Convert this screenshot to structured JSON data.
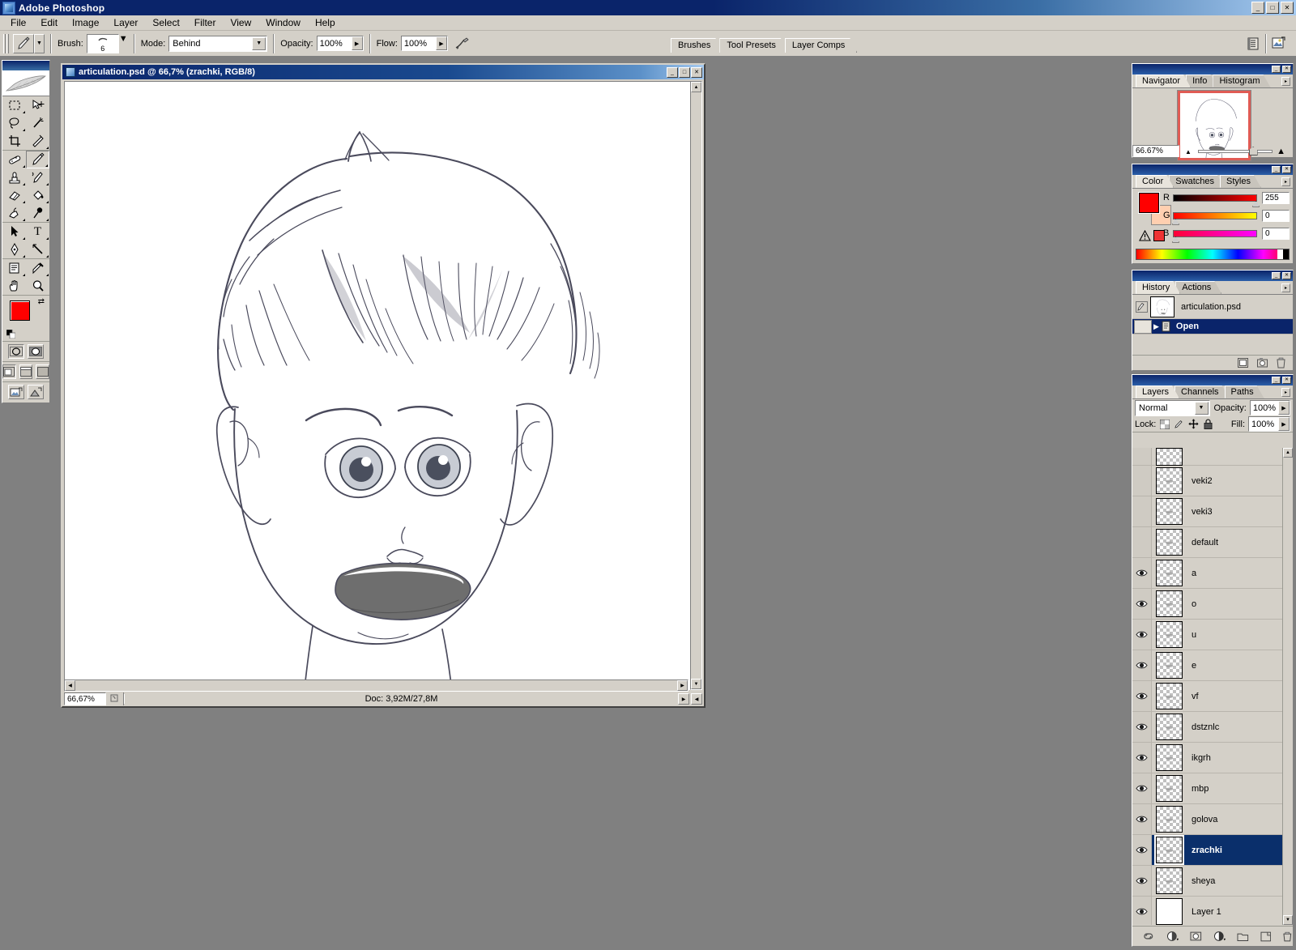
{
  "app": {
    "title": "Adobe Photoshop",
    "window_buttons": [
      "_",
      "□",
      "✕"
    ]
  },
  "menubar": {
    "items": [
      "File",
      "Edit",
      "Image",
      "Layer",
      "Select",
      "Filter",
      "View",
      "Window",
      "Help"
    ]
  },
  "options_bar": {
    "brush_label": "Brush:",
    "brush_size": "6",
    "mode_label": "Mode:",
    "mode_value": "Behind",
    "opacity_label": "Opacity:",
    "opacity_value": "100%",
    "flow_label": "Flow:",
    "flow_value": "100%",
    "airbrush_icon": "airbrush-icon",
    "brushes_palette_icon": "brushes-palette-icon",
    "file-browser_icon": "file-browser-icon"
  },
  "palette_well": {
    "tabs": [
      "Brushes",
      "Tool Presets",
      "Layer Comps"
    ]
  },
  "toolbox": {
    "tools": [
      {
        "name": "marquee-tool",
        "glyph": "▭"
      },
      {
        "name": "move-tool",
        "glyph": "✛"
      },
      {
        "name": "lasso-tool",
        "glyph": "◌"
      },
      {
        "name": "magic-wand-tool",
        "glyph": "✳"
      },
      {
        "name": "crop-tool",
        "glyph": "⌗"
      },
      {
        "name": "slice-tool",
        "glyph": "✂"
      },
      {
        "name": "healing-brush-tool",
        "glyph": "▰"
      },
      {
        "name": "brush-tool",
        "glyph": "🖌"
      },
      {
        "name": "clone-stamp-tool",
        "glyph": "⚲"
      },
      {
        "name": "history-brush-tool",
        "glyph": "↯"
      },
      {
        "name": "eraser-tool",
        "glyph": "▱"
      },
      {
        "name": "gradient-tool",
        "glyph": "◧"
      },
      {
        "name": "blur-tool",
        "glyph": "💧"
      },
      {
        "name": "dodge-tool",
        "glyph": "◍"
      },
      {
        "name": "path-selection-tool",
        "glyph": "➤"
      },
      {
        "name": "type-tool",
        "glyph": "T"
      },
      {
        "name": "pen-tool",
        "glyph": "✒"
      },
      {
        "name": "line-tool",
        "glyph": "╲"
      },
      {
        "name": "notes-tool",
        "glyph": "▤"
      },
      {
        "name": "eyedropper-tool",
        "glyph": "⟋"
      },
      {
        "name": "hand-tool",
        "glyph": "✋"
      },
      {
        "name": "zoom-tool",
        "glyph": "🔍"
      }
    ],
    "foreground_color": "#ff0000",
    "background_color": "#ffcfb0",
    "quickmask_modes": [
      "standard-mask-mode",
      "quick-mask-mode"
    ],
    "screen_modes": [
      "standard-screen-mode",
      "full-screen-with-menubar",
      "full-screen-mode"
    ]
  },
  "document": {
    "title": "articulation.psd @ 66,7% (zrachki, RGB/8)",
    "window_buttons": [
      "_",
      "□",
      "✕"
    ],
    "status": {
      "zoom": "66,67%",
      "doc_info": "Doc: 3,92M/27,8M"
    }
  },
  "navigator": {
    "tabs": [
      "Navigator",
      "Info",
      "Histogram"
    ],
    "active_tab": "Navigator",
    "zoom_value": "66.67%",
    "view_box_color": "#e05b54"
  },
  "color": {
    "tabs": [
      "Color",
      "Swatches",
      "Styles"
    ],
    "active_tab": "Color",
    "channels": [
      {
        "label": "R",
        "value": "255"
      },
      {
        "label": "G",
        "value": "0"
      },
      {
        "label": "B",
        "value": "0"
      }
    ],
    "foreground": "#ff0000",
    "background": "#ffcfb0",
    "out_of_gamut_icon": "gamut-warning-icon"
  },
  "history": {
    "tabs": [
      "History",
      "Actions"
    ],
    "active_tab": "History",
    "snapshot": "articulation.psd",
    "states": [
      {
        "label": "Open",
        "selected": true
      }
    ],
    "buttons": [
      "new-document-from-state-button",
      "new-snapshot-button",
      "delete-state-button"
    ]
  },
  "layers": {
    "tabs": [
      "Layers",
      "Channels",
      "Paths"
    ],
    "active_tab": "Layers",
    "blend_mode": "Normal",
    "opacity_label": "Opacity:",
    "opacity_value": "100%",
    "lock_label": "Lock:",
    "fill_label": "Fill:",
    "fill_value": "100%",
    "lock_icons": [
      "lock-transparency-icon",
      "lock-image-icon",
      "lock-position-icon",
      "lock-all-icon"
    ],
    "items": [
      {
        "name": "",
        "visible": false,
        "selected": false,
        "partial": true,
        "thumb": "transparent"
      },
      {
        "name": "veki2",
        "visible": false,
        "selected": false,
        "thumb": "transparent"
      },
      {
        "name": "veki3",
        "visible": false,
        "selected": false,
        "thumb": "transparent"
      },
      {
        "name": "default",
        "visible": false,
        "selected": false,
        "thumb": "transparent"
      },
      {
        "name": "a",
        "visible": true,
        "selected": false,
        "thumb": "transparent"
      },
      {
        "name": "o",
        "visible": true,
        "selected": false,
        "thumb": "transparent"
      },
      {
        "name": "u",
        "visible": true,
        "selected": false,
        "thumb": "transparent"
      },
      {
        "name": "e",
        "visible": true,
        "selected": false,
        "thumb": "transparent"
      },
      {
        "name": "vf",
        "visible": true,
        "selected": false,
        "thumb": "transparent"
      },
      {
        "name": "dstznlc",
        "visible": true,
        "selected": false,
        "thumb": "transparent"
      },
      {
        "name": "ikgrh",
        "visible": true,
        "selected": false,
        "thumb": "transparent"
      },
      {
        "name": "mbp",
        "visible": true,
        "selected": false,
        "thumb": "transparent"
      },
      {
        "name": "golova",
        "visible": true,
        "selected": false,
        "thumb": "transparent"
      },
      {
        "name": "zrachki",
        "visible": true,
        "selected": true,
        "thumb": "transparent"
      },
      {
        "name": "sheya",
        "visible": true,
        "selected": false,
        "thumb": "transparent"
      },
      {
        "name": "Layer 1",
        "visible": true,
        "selected": false,
        "thumb": "white"
      }
    ],
    "buttons": [
      "link-layers-button",
      "layer-style-button",
      "layer-mask-button",
      "adjustment-layer-button",
      "new-group-button",
      "new-layer-button",
      "delete-layer-button"
    ]
  }
}
